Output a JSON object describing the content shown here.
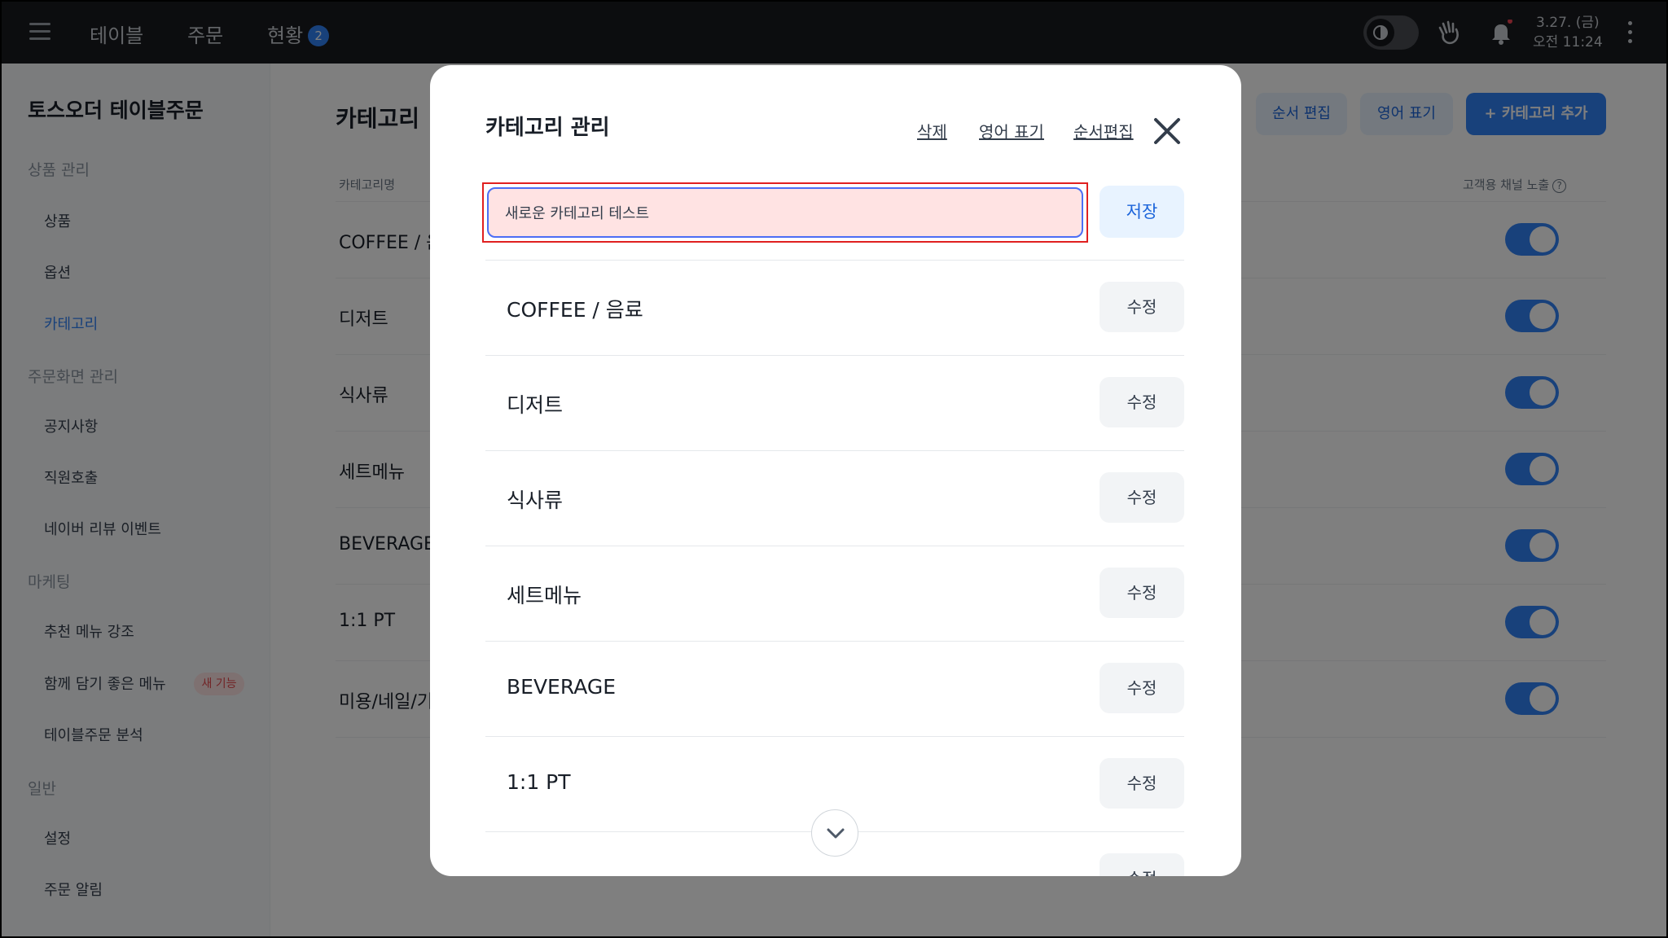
{
  "topbar": {
    "nav": [
      {
        "label": "테이블"
      },
      {
        "label": "주문"
      },
      {
        "label": "현황",
        "badge": "2"
      }
    ],
    "datetime": {
      "date": "3.27. (금)",
      "time": "오전 11:24"
    },
    "icons": [
      "menu-icon",
      "theme-toggle",
      "hand-wave-icon",
      "bell-icon",
      "kebab-icon"
    ]
  },
  "sidebar": {
    "title": "토스오더 테이블주문",
    "sections": [
      {
        "label": "상품 관리",
        "items": [
          "상품",
          "옵션",
          "카테고리"
        ]
      },
      {
        "label": "주문화면 관리",
        "items": [
          "공지사항",
          "직원호출",
          "네이버 리뷰 이벤트"
        ]
      },
      {
        "label": "마케팅",
        "items": [
          "추천 메뉴 강조",
          "함께 담기 좋은 메뉴",
          "테이블주문 분석"
        ],
        "new_badge": "새 기능"
      },
      {
        "label": "일반",
        "items": [
          "설정",
          "주문 알림"
        ]
      }
    ],
    "active_item": "카테고리"
  },
  "main": {
    "title": "카테고리",
    "buttons": {
      "order_edit": "순서 편집",
      "english": "영어 표기",
      "add": "+ 카테고리 추가"
    },
    "columns": {
      "name": "카테고리명",
      "channel": "고객용 채널 노출"
    },
    "rows": [
      "COFFEE / 음",
      "디저트",
      "식사류",
      "세트메뉴",
      "BEVERAGE",
      "1:1 PT",
      "미용/네일/기"
    ]
  },
  "modal": {
    "title": "카테고리 관리",
    "links": {
      "delete": "삭제",
      "english": "영어 표기",
      "order": "순서편집"
    },
    "input_value": "새로운 카테고리 테스트",
    "save_label": "저장",
    "edit_label": "수정",
    "categories": [
      "COFFEE / 음료",
      "디저트",
      "식사류",
      "세트메뉴",
      "BEVERAGE",
      "1:1 PT"
    ]
  },
  "colors": {
    "accent": "#3182f6",
    "highlight_border": "#e02020",
    "input_bg": "#ffe3e3"
  }
}
